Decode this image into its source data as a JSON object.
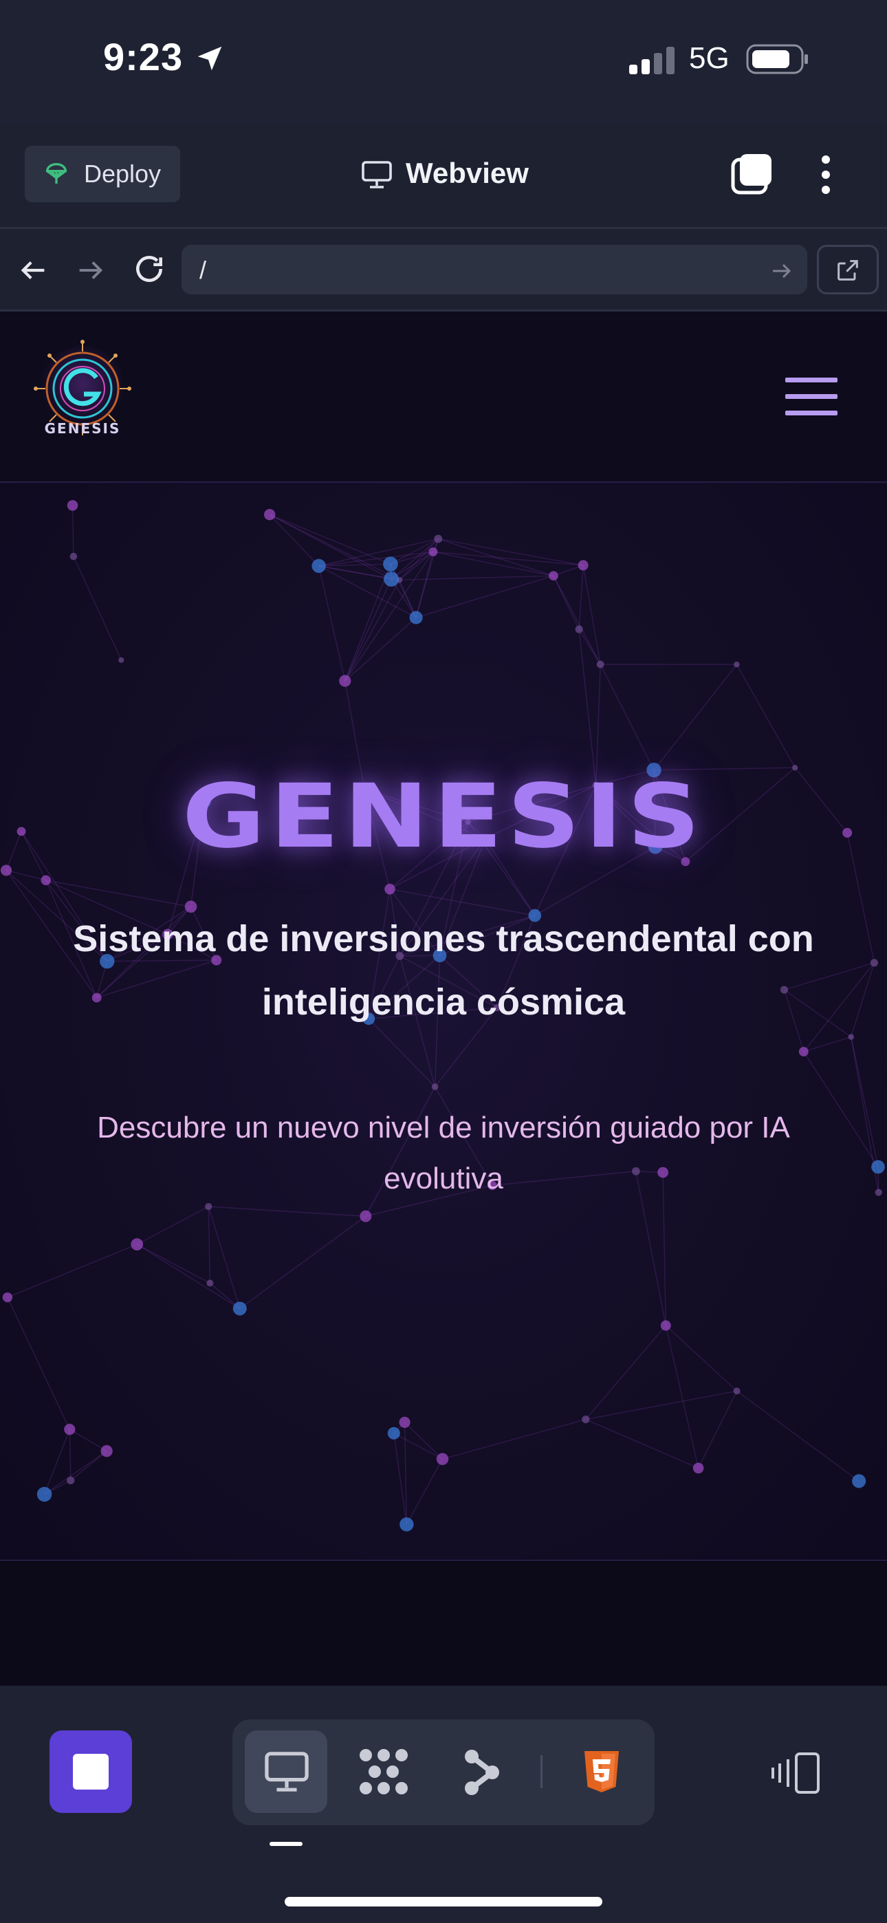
{
  "status_bar": {
    "time": "9:23",
    "network": "5G"
  },
  "toolbar": {
    "deploy_label": "Deploy",
    "webview_label": "Webview"
  },
  "address": {
    "url": "/"
  },
  "site": {
    "logo_text": "GENESIS",
    "hero_title": "GENESIS",
    "hero_subtitle": "Sistema de inversiones trascendental con inteligencia cósmica",
    "hero_description": "Descubre un nuevo nivel de inversión guiado por IA evolutiva"
  },
  "colors": {
    "accent": "#a67cf2",
    "stop_button": "#5b3fd6",
    "html_icon": "#e2631f",
    "deploy_icon": "#3fbf7f",
    "menu_lines": "#b89cf0"
  },
  "icons": [
    "location-arrow-icon",
    "signal-icon",
    "battery-icon",
    "deploy-icon",
    "monitor-icon",
    "tabs-icon",
    "more-icon",
    "back-icon",
    "forward-icon",
    "reload-icon",
    "go-icon",
    "external-link-icon",
    "hamburger-icon",
    "stop-icon",
    "workflow-icon",
    "branch-icon",
    "html5-icon",
    "device-toggle-icon"
  ]
}
